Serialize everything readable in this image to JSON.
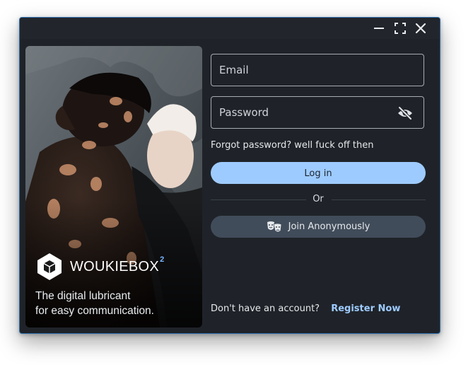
{
  "window": {
    "minimize_icon": "minimize-icon",
    "maximize_icon": "fullscreen-icon",
    "close_icon": "close-icon"
  },
  "hero": {
    "brand_name": "WOUKIEBOX",
    "brand_superscript": "2",
    "tagline_line1": "The digital lubricant",
    "tagline_line2": "for easy communication."
  },
  "form": {
    "email_placeholder": "Email",
    "email_value": "",
    "password_placeholder": "Password",
    "password_value": "",
    "password_toggle_icon": "eye-off-icon",
    "forgot_password": "Forgot password? well fuck off then",
    "login_label": "Log in",
    "divider_label": "Or",
    "anonymous_label": "Join Anonymously",
    "anonymous_icon": "theater-masks-icon"
  },
  "footer": {
    "question": "Don't have an account?",
    "register_label": "Register Now"
  },
  "colors": {
    "window_bg": "#1f2329",
    "accent": "#9ecbff",
    "anon_button": "#414c5a",
    "border": "#2f6fae"
  }
}
